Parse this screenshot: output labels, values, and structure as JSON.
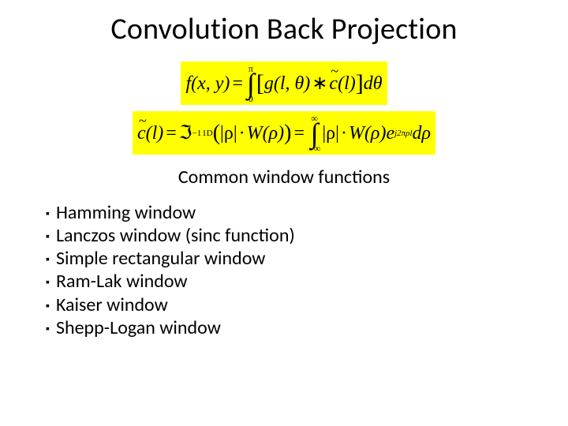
{
  "title": "Convolution Back Projection",
  "eq1": {
    "lhs": "f(x, y)",
    "eq": "=",
    "int_upper": "π",
    "int_lower": "0",
    "open": "[",
    "g": "g",
    "g_args": "(l, θ)",
    "conv": "∗",
    "c": "c",
    "c_args": "(l)",
    "close": "]",
    "d": "d",
    "dvar": "θ"
  },
  "eq2": {
    "c": "c",
    "c_args": "(l)",
    "eq": "=",
    "F": "ℑ",
    "F_sub": "1D",
    "F_sup": "−1",
    "open1": "(",
    "abs_rho": "|ρ|",
    "dot": "·",
    "W": "W",
    "W_args": "(ρ)",
    "close1": ")",
    "eq2": "=",
    "int_upper": "∞",
    "int_lower": "−∞",
    "e": "e",
    "e_sup": "j2πρl",
    "d": "d",
    "dvar": "ρ"
  },
  "subtitle": "Common window functions",
  "bullets": [
    "Hamming window",
    "Lanczos window (sinc function)",
    "Simple rectangular window",
    "Ram-Lak window",
    "Kaiser window",
    "Shepp-Logan window"
  ]
}
